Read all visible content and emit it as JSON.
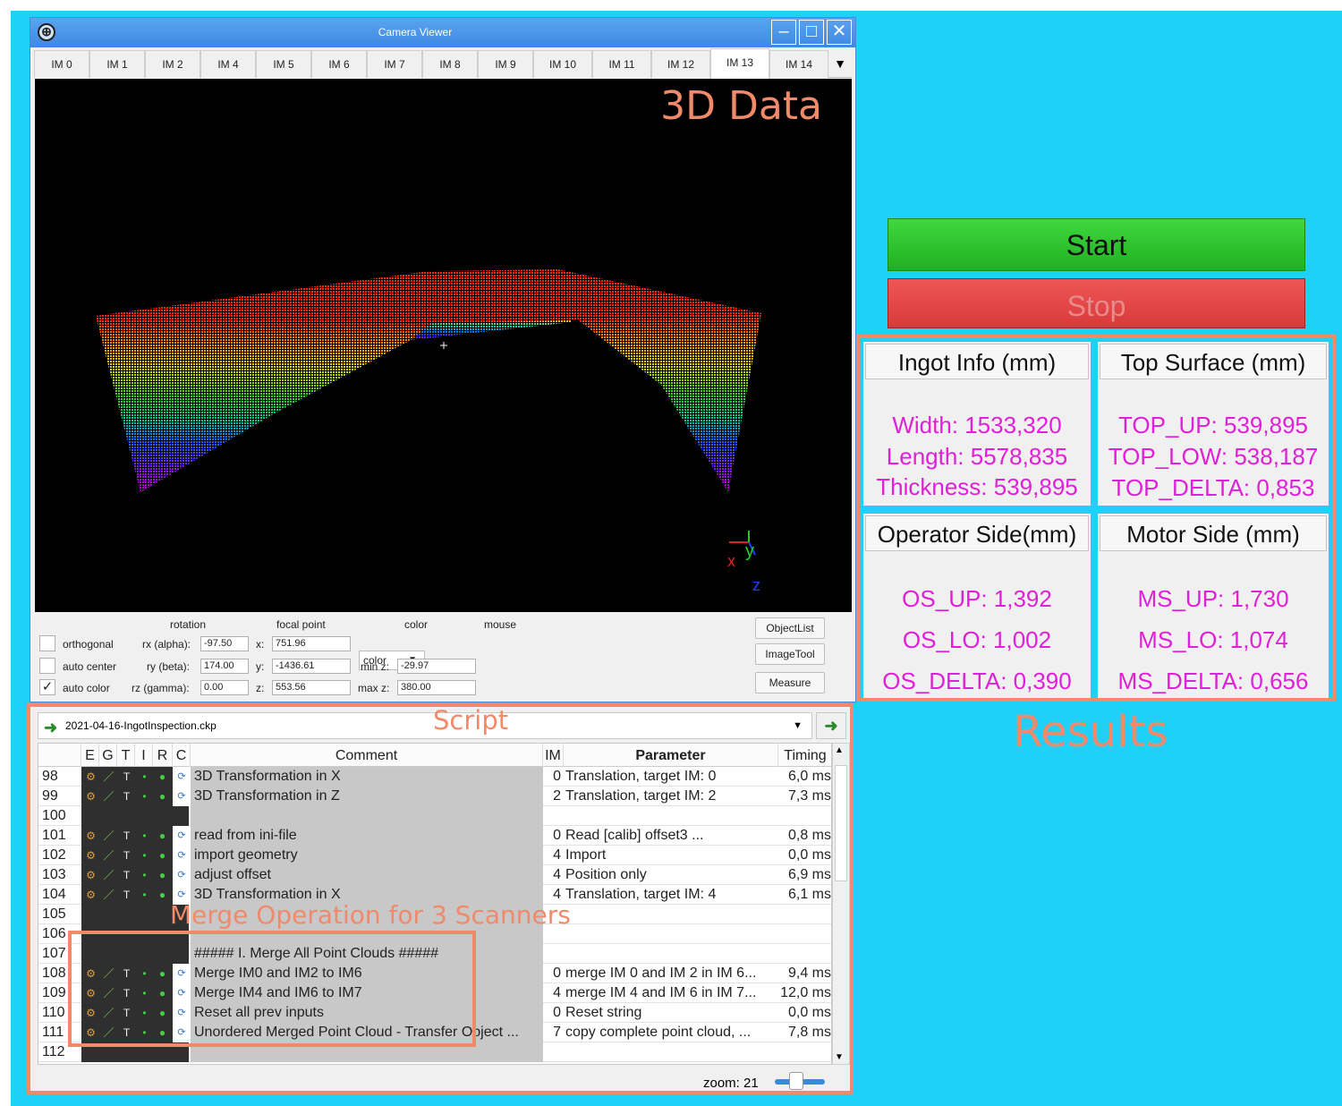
{
  "window": {
    "title": "Camera Viewer",
    "minimize": "–",
    "maximize": "□",
    "close": "✕"
  },
  "tabs": [
    "IM 0",
    "IM 1",
    "IM 2",
    "IM 4",
    "IM 5",
    "IM 6",
    "IM 7",
    "IM 8",
    "IM 9",
    "IM 10",
    "IM 11",
    "IM 12",
    "IM 13",
    "IM 14"
  ],
  "active_tab": "IM 13",
  "viewer": {
    "overlay_title": "3D Data",
    "axis_x": "x",
    "axis_y": "y",
    "axis_z": "z"
  },
  "controls": {
    "headers": {
      "rotation": "rotation",
      "focal_point": "focal point",
      "color": "color",
      "mouse": "mouse"
    },
    "checkboxes": [
      {
        "label": "orthogonal",
        "checked": false
      },
      {
        "label": "auto center",
        "checked": false
      },
      {
        "label": "auto color",
        "checked": true
      }
    ],
    "rotation": [
      {
        "label": "rx (alpha):",
        "value": "-97.50"
      },
      {
        "label": "ry (beta):",
        "value": "174.00"
      },
      {
        "label": "rz (gamma):",
        "value": "0.00"
      }
    ],
    "focal": [
      {
        "label": "x:",
        "value": "751.96"
      },
      {
        "label": "y:",
        "value": "-1436.61"
      },
      {
        "label": "z:",
        "value": "553.56"
      }
    ],
    "color_select": "color",
    "min_z_label": "min z:",
    "min_z": "-29.97",
    "max_z_label": "max z:",
    "max_z": "380.00",
    "buttons": {
      "objectlist": "ObjectList",
      "imagetool": "ImageTool",
      "measure": "Measure"
    }
  },
  "script": {
    "file": "2021-04-16-IngotInspection.ckp",
    "annotation": "Script",
    "columns": {
      "e": "E",
      "g": "G",
      "t": "T",
      "i": "I",
      "r": "R",
      "c": "C",
      "comment": "Comment",
      "im": "IM",
      "parameter": "Parameter",
      "timing": "Timing"
    },
    "rows": [
      {
        "n": "98",
        "icons": true,
        "comment": "3D Transformation in X",
        "im": "0",
        "param": "Translation, target IM: 0",
        "time": "6,0 ms"
      },
      {
        "n": "99",
        "icons": true,
        "comment": "3D Transformation in Z",
        "im": "2",
        "param": "Translation, target IM: 2",
        "time": "7,3 ms"
      },
      {
        "n": "100",
        "icons": false,
        "comment": "",
        "im": "",
        "param": "",
        "time": ""
      },
      {
        "n": "101",
        "icons": true,
        "comment": "read from ini-file",
        "im": "0",
        "param": "Read [calib] offset3 ...",
        "time": "0,8 ms"
      },
      {
        "n": "102",
        "icons": true,
        "comment": "import geometry",
        "im": "4",
        "param": "Import",
        "time": "0,0 ms"
      },
      {
        "n": "103",
        "icons": true,
        "comment": "adjust offset",
        "im": "4",
        "param": "Position only",
        "time": "6,9 ms"
      },
      {
        "n": "104",
        "icons": true,
        "comment": "3D Transformation in X",
        "im": "4",
        "param": "Translation, target IM: 4",
        "time": "6,1 ms"
      },
      {
        "n": "105",
        "icons": false,
        "comment": "",
        "im": "",
        "param": "",
        "time": ""
      },
      {
        "n": "106",
        "icons": false,
        "comment": "",
        "im": "",
        "param": "",
        "time": ""
      },
      {
        "n": "107",
        "icons": false,
        "comment": "##### I. Merge All Point Clouds #####",
        "im": "",
        "param": "",
        "time": ""
      },
      {
        "n": "108",
        "icons": true,
        "comment": "Merge IM0 and IM2 to IM6",
        "im": "0",
        "param": "merge IM 0 and IM 2 in IM 6...",
        "time": "9,4 ms"
      },
      {
        "n": "109",
        "icons": true,
        "comment": "Merge IM4 and IM6 to IM7",
        "im": "4",
        "param": "merge IM 4 and IM 6 in IM 7...",
        "time": "12,0 ms"
      },
      {
        "n": "110",
        "icons": true,
        "comment": "Reset all prev inputs",
        "im": "0",
        "param": "Reset string",
        "time": "0,0 ms"
      },
      {
        "n": "111",
        "icons": true,
        "comment": "Unordered Merged Point Cloud - Transfer Object ...",
        "im": "7",
        "param": "copy complete point cloud, ...",
        "time": "7,8 ms"
      },
      {
        "n": "112",
        "icons": false,
        "comment": "",
        "im": "",
        "param": "",
        "time": ""
      }
    ],
    "merge_annotation": "Merge Operation for 3 Scanners",
    "zoom": "zoom: 21"
  },
  "actions": {
    "start": "Start",
    "stop": "Stop"
  },
  "results": {
    "annotation": "Results",
    "ingot": {
      "title": "Ingot Info (mm)",
      "lines": [
        "Width: 1533,320",
        "Length: 5578,835",
        "Thickness: 539,895"
      ]
    },
    "top": {
      "title": "Top Surface (mm)",
      "lines": [
        "TOP_UP: 539,895",
        "TOP_LOW: 538,187",
        "TOP_DELTA: 0,853"
      ]
    },
    "operator": {
      "title": "Operator Side(mm)",
      "lines": [
        "OS_UP: 1,392",
        "OS_LO: 1,002",
        "OS_DELTA: 0,390"
      ]
    },
    "motor": {
      "title": "Motor Side (mm)",
      "lines": [
        "MS_UP: 1,730",
        "MS_LO: 1,074",
        "MS_DELTA: 0,656"
      ]
    }
  },
  "colors": {
    "background": "#1fd0f8",
    "annotation": "#f08a6a",
    "value_text": "#e020d8",
    "start": "#2ec42e",
    "stop": "#e04848"
  }
}
